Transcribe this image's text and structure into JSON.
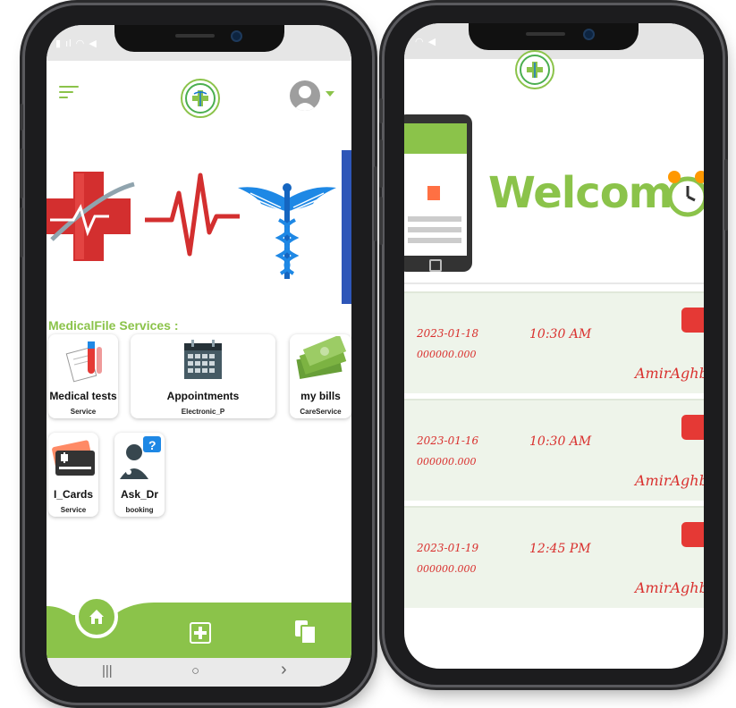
{
  "left_screen": {
    "header": {
      "menu_icon": "menu-icon",
      "logo_icon": "caduceus-logo-icon",
      "avatar_icon": "user-avatar-icon"
    },
    "section_title": "MedicalFile Services :",
    "services": [
      {
        "title": "Medical tests",
        "subtitle": "Service",
        "icon": "test-tube-icon"
      },
      {
        "title": "Appointments",
        "subtitle": "Electronic_P",
        "icon": "calendar-icon"
      },
      {
        "title": "my bills",
        "subtitle": "CareService",
        "icon": "money-icon"
      },
      {
        "title": "I_Cards",
        "subtitle": "Service",
        "icon": "credit-card-icon"
      },
      {
        "title": "Ask_Dr",
        "subtitle": "booking",
        "icon": "doctor-question-icon"
      }
    ],
    "bottom_nav": {
      "home_icon": "home-icon",
      "add_icon": "plus-square-icon",
      "files_icon": "documents-icon"
    },
    "system_nav": {
      "recent": "|||",
      "home": "○",
      "back": "›"
    }
  },
  "right_screen": {
    "welcome_text": "Welcome",
    "appointments": [
      {
        "date": "2023-01-18",
        "code": "000000.000",
        "time": "10:30 AM",
        "name": "AmirAghba"
      },
      {
        "date": "2023-01-16",
        "code": "000000.000",
        "time": "10:30 AM",
        "name": "AmirAghba"
      },
      {
        "date": "2023-01-19",
        "code": "000000.000",
        "time": "12:45 PM",
        "name": "AmirAghba"
      }
    ]
  },
  "colors": {
    "accent": "#8bc34a",
    "danger": "#d9302e",
    "blue": "#2e56b8"
  }
}
